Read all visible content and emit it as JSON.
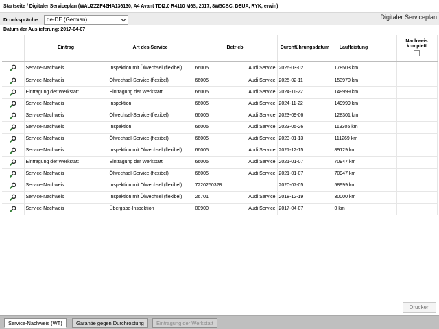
{
  "breadcrumb": "Startseite / Digitaler Serviceplan (WAUZZZF42HA136130, A4 Avant TDI2.0 R4110 M6S, 2017, 8W5CBC, DEUA, RYK, erwin)",
  "print_language": {
    "label": "Druckspräche:",
    "value": "de-DE (German)"
  },
  "page_heading": "Digitaler Serviceplan",
  "delivery_date": "Datum der Auslieferung: 2017-04-07",
  "table": {
    "headers": {
      "entry": "Eintrag",
      "service_type": "Art des Service",
      "workshop": "Betrieb",
      "date": "Durchführungsdatum",
      "mileage": "Laufleistung",
      "proof_complete": "Nachweis komplett"
    },
    "rows": [
      {
        "entry": "Service-Nachweis",
        "service_type": "Inspektion mit Ölwechsel (flexibel)",
        "workshop_no": "66005",
        "workshop_name": "Audi Service",
        "date": "2026-03-02",
        "mileage": "178503 km"
      },
      {
        "entry": "Service-Nachweis",
        "service_type": "Ölwechsel-Service (flexibel)",
        "workshop_no": "66005",
        "workshop_name": "Audi Service",
        "date": "2025-02-11",
        "mileage": "153970 km"
      },
      {
        "entry": "Eintragung der Werkstatt",
        "service_type": "Eintragung der Werkstatt",
        "workshop_no": "66005",
        "workshop_name": "Audi Service",
        "date": "2024-11-22",
        "mileage": "149999 km"
      },
      {
        "entry": "Service-Nachweis",
        "service_type": "Inspektion",
        "workshop_no": "66005",
        "workshop_name": "Audi Service",
        "date": "2024-11-22",
        "mileage": "149999 km"
      },
      {
        "entry": "Service-Nachweis",
        "service_type": "Ölwechsel-Service (flexibel)",
        "workshop_no": "66005",
        "workshop_name": "Audi Service",
        "date": "2023-09-06",
        "mileage": "128301 km"
      },
      {
        "entry": "Service-Nachweis",
        "service_type": "Inspektion",
        "workshop_no": "66005",
        "workshop_name": "Audi Service",
        "date": "2023-05-26",
        "mileage": "119305 km"
      },
      {
        "entry": "Service-Nachweis",
        "service_type": "Ölwechsel-Service (flexibel)",
        "workshop_no": "66005",
        "workshop_name": "Audi Service",
        "date": "2023-01-13",
        "mileage": "111269 km"
      },
      {
        "entry": "Service-Nachweis",
        "service_type": "Inspektion mit Ölwechsel (flexibel)",
        "workshop_no": "66005",
        "workshop_name": "Audi Service",
        "date": "2021-12-15",
        "mileage": "89129 km"
      },
      {
        "entry": "Eintragung der Werkstatt",
        "service_type": "Eintragung der Werkstatt",
        "workshop_no": "66005",
        "workshop_name": "Audi Service",
        "date": "2021-01-07",
        "mileage": "70947 km"
      },
      {
        "entry": "Service-Nachweis",
        "service_type": "Ölwechsel-Service (flexibel)",
        "workshop_no": "66005",
        "workshop_name": "Audi Service",
        "date": "2021-01-07",
        "mileage": "70947 km"
      },
      {
        "entry": "Service-Nachweis",
        "service_type": "Inspektion mit Ölwechsel (flexibel)",
        "workshop_no": "7220250328",
        "workshop_name": "",
        "date": "2020-07-05",
        "mileage": "58999 km"
      },
      {
        "entry": "Service-Nachweis",
        "service_type": "Inspektion mit Ölwechsel (flexibel)",
        "workshop_no": "26701",
        "workshop_name": "Audi Service",
        "date": "2018-12-19",
        "mileage": "30000 km"
      },
      {
        "entry": "Service-Nachweis",
        "service_type": "Übergabe-Inspektion",
        "workshop_no": "00900",
        "workshop_name": "Audi Service",
        "date": "2017-04-07",
        "mileage": "0 km"
      }
    ]
  },
  "print_button": "Drucken",
  "tabs": [
    {
      "label": "Service-Nachweis (WT)",
      "state": "active"
    },
    {
      "label": "Garantie gegen Durchrostung",
      "state": "normal"
    },
    {
      "label": "Eintragung der Werkstatt",
      "state": "disabled"
    }
  ],
  "icons": {
    "row_action": "magnifier-icon",
    "select": "chevron-down-icon"
  },
  "colors": {
    "magnifier_handle": "#2e7d32",
    "magnifier_lens": "#1f1f1f",
    "tabbar": "#bfbfbf",
    "header_band": "#ececec"
  }
}
